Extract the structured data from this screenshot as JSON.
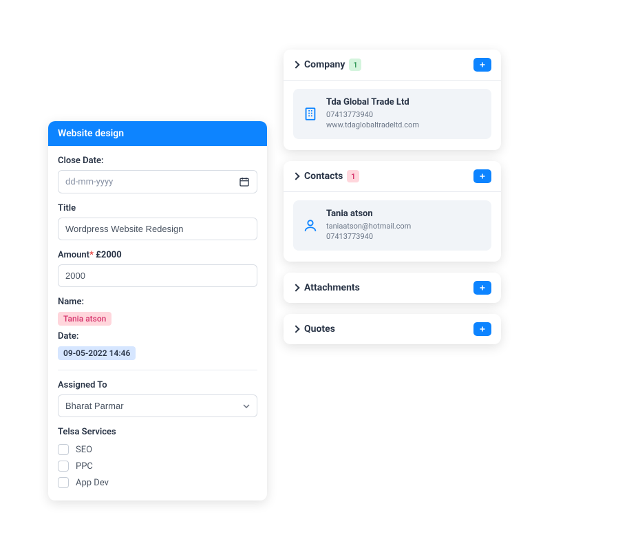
{
  "form": {
    "header": "Website design",
    "closeDate": {
      "label": "Close Date:",
      "placeholder": "dd-mm-yyyy"
    },
    "title": {
      "label": "Title",
      "value": "Wordpress Website Redesign"
    },
    "amount": {
      "label": "Amount",
      "display": "£2000",
      "value": "2000"
    },
    "name": {
      "label": "Name:",
      "tag": "Tania atson"
    },
    "date": {
      "label": "Date:",
      "tag": "09-05-2022 14:46"
    },
    "assignedTo": {
      "label": "Assigned To",
      "value": "Bharat Parmar"
    },
    "servicesLabel": "Telsa Services",
    "services": [
      {
        "label": "SEO"
      },
      {
        "label": "PPC"
      },
      {
        "label": "App Dev"
      }
    ]
  },
  "company": {
    "title": "Company",
    "count": "1",
    "item": {
      "name": "Tda Global Trade Ltd",
      "phone": "07413773940",
      "website": "www.tdaglobaltradeltd.com"
    }
  },
  "contacts": {
    "title": "Contacts",
    "count": "1",
    "item": {
      "name": "Tania atson",
      "email": "taniaatson@hotmail.com",
      "phone": "07413773940"
    }
  },
  "attachments": {
    "title": "Attachments"
  },
  "quotes": {
    "title": "Quotes"
  }
}
